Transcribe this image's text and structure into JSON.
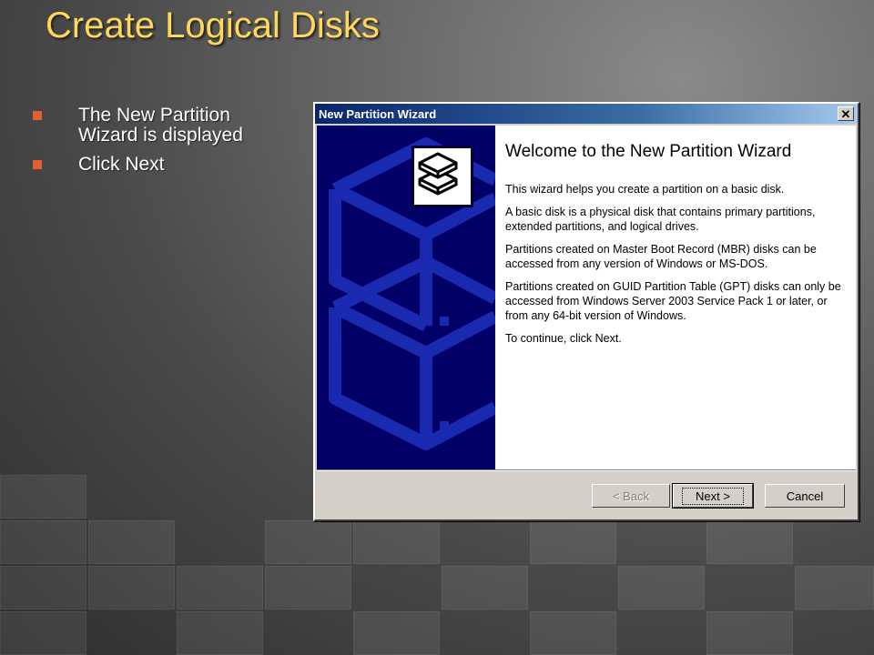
{
  "slide": {
    "title": "Create Logical Disks",
    "bullets": [
      "The New Partition Wizard is displayed",
      "Click Next"
    ]
  },
  "dialog": {
    "title": "New Partition Wizard",
    "heading": "Welcome to the New Partition Wizard",
    "paragraphs": [
      "This wizard helps you create a partition on a basic disk.",
      "A basic disk is a physical disk that contains primary partitions, extended partitions, and logical drives.",
      "Partitions created on Master Boot Record (MBR) disks can be accessed from any version of Windows or MS-DOS.",
      "Partitions created on GUID Partition Table (GPT) disks can only be accessed from Windows Server 2003 Service Pack 1 or later, or from any 64-bit version of Windows.",
      "To continue, click Next."
    ],
    "buttons": {
      "back": "< Back",
      "next": "Next >",
      "cancel": "Cancel"
    },
    "close_icon": "close-icon",
    "logo_icon": "disk-stack-icon"
  },
  "colors": {
    "title": "#ffd75a",
    "bullet": "#e06030",
    "titlebar_start": "#0a246a",
    "banner": "#000066"
  }
}
